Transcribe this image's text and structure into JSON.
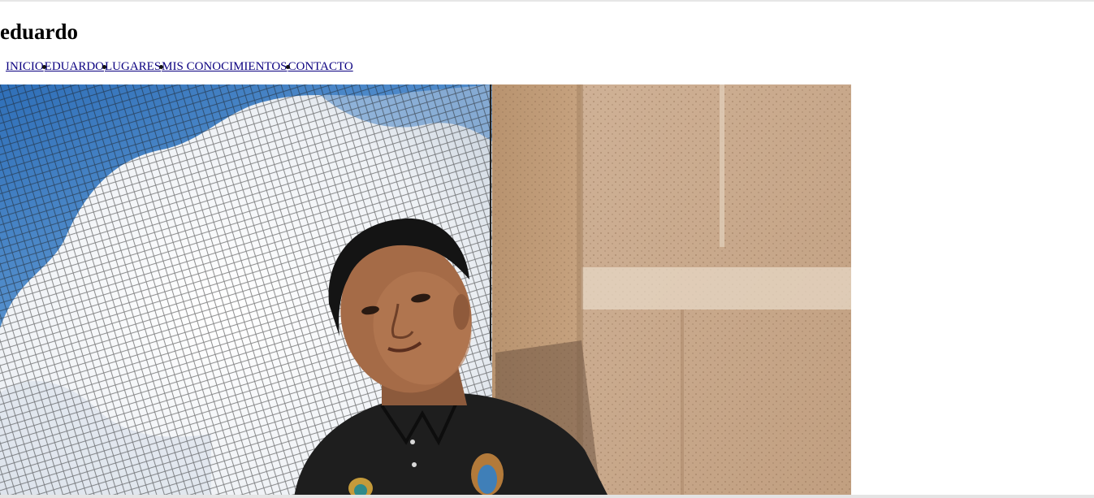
{
  "site": {
    "title": "eduardo"
  },
  "nav": {
    "items": [
      {
        "label": "INICIO"
      },
      {
        "label": "EDUARDO"
      },
      {
        "label": "LUGARES"
      },
      {
        "label": "MIS CONOCIMIENTOS"
      },
      {
        "label": "CONTACTO"
      }
    ]
  },
  "colors": {
    "link": "#0b0080",
    "sky": "#4a86c8",
    "cloud": "#f2f4f7",
    "wall": "#c9a887",
    "shirt": "#1e1e1e"
  }
}
